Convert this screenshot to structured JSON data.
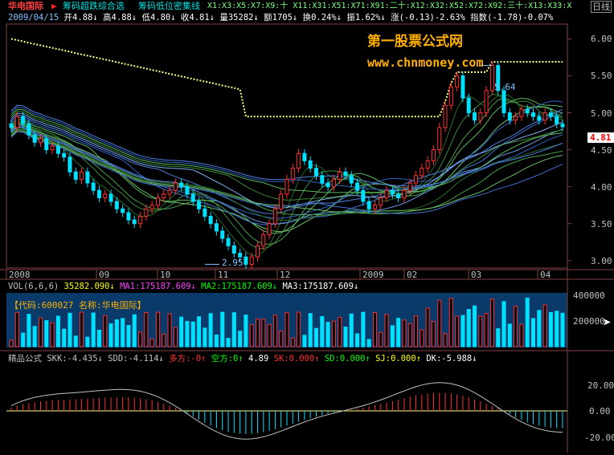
{
  "header": {
    "stock_name": "华电国际",
    "tab1": "筹码超跌综合选",
    "tab2": "筹码低位密集线",
    "ma_list": "X1:X3:X5:X7:X9:十 X11:X31:X51:X71:X91:二十:X12:X32:X52:X72:X92:三十:X13:X33:X",
    "corner_button": "日线"
  },
  "quote": {
    "date": "2009/04/15",
    "open": "开4.88",
    "high": "高4.88",
    "low": "低4.80",
    "close": "收4.81",
    "volume": "量35282",
    "amount": "额1705",
    "turnover": "换0.24%",
    "amplitude": "振1.62%",
    "change": "涨(-0.13)-2.63%",
    "index": "指数(-1.78)-0.07%"
  },
  "watermark": {
    "line1": "第一股票公式网",
    "line2": "www.chnmoney.com"
  },
  "colors": {
    "up": "#ff3030",
    "down": "#00e0ff",
    "yellow": "#ffff00",
    "panel_bg_vol": "#0a3a6a"
  },
  "vol_panel": {
    "title": "VOL(6,6,6)",
    "vol": "35282.090",
    "ma1": "MA1:175187.609",
    "ma2": "MA2:175187.609",
    "ma3": "MA3:175187.609",
    "info": "【代码:600027 名称:华电国际】",
    "yticks": [
      "400000",
      "200000"
    ]
  },
  "ind_panel": {
    "title": "精品公式",
    "skk": "SKK:-4.435",
    "sdd": "SDD:-4.114",
    "duo": "多方:-0",
    "kong": "空方:0",
    "kong_val": "4.89",
    "sk": "SK:0.000",
    "sd": "SD:0.000",
    "sj": "SJ:0.000",
    "dk": "DK:-5.988",
    "yticks": [
      "20.00",
      "0.00",
      "-20.00"
    ]
  },
  "chart_data": {
    "type": "candlestick",
    "yticks": [
      "6.00",
      "5.50",
      "5.00",
      "4.50",
      "4.00",
      "3.50",
      "3.00"
    ],
    "ylim": [
      2.9,
      6.2
    ],
    "xticks": [
      "2008",
      "09",
      "10",
      "11",
      "12",
      "2009",
      "02",
      "03",
      "04"
    ],
    "annotations": [
      {
        "text": "5.64",
        "value": 5.64
      },
      {
        "text": "2.95",
        "value": 2.95
      }
    ],
    "last_price": "4.81",
    "series_close": [
      4.8,
      4.95,
      4.85,
      4.7,
      4.6,
      4.65,
      4.5,
      4.55,
      4.45,
      4.4,
      4.2,
      4.1,
      4.2,
      4.05,
      3.95,
      3.85,
      3.9,
      3.8,
      3.7,
      3.65,
      3.55,
      3.5,
      3.6,
      3.7,
      3.75,
      3.85,
      3.9,
      3.95,
      4.05,
      4.0,
      3.9,
      3.8,
      3.7,
      3.6,
      3.5,
      3.4,
      3.3,
      3.2,
      3.1,
      3.05,
      2.95,
      3.05,
      3.2,
      3.35,
      3.5,
      3.7,
      3.9,
      4.1,
      4.25,
      4.45,
      4.35,
      4.25,
      4.15,
      4.05,
      4.0,
      4.1,
      4.2,
      4.15,
      4.05,
      3.95,
      3.8,
      3.7,
      3.75,
      3.85,
      3.95,
      3.9,
      3.85,
      3.95,
      4.05,
      4.15,
      4.25,
      4.35,
      4.5,
      4.8,
      5.1,
      5.35,
      5.5,
      5.2,
      5.0,
      4.9,
      5.0,
      5.3,
      5.64,
      5.3,
      5.0,
      4.9,
      4.95,
      5.05,
      5.0,
      4.95,
      4.9,
      5.0,
      4.95,
      4.85,
      4.81
    ]
  }
}
